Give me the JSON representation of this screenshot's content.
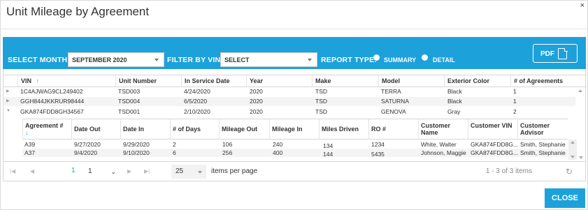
{
  "dialog": {
    "title": "Unit Mileage by Agreement",
    "close_icon": "×"
  },
  "filters": {
    "month_label": "SELECT MONTH:",
    "month_value": "SEPTEMBER 2020",
    "vin_label": "FILTER BY VIN:",
    "vin_value": "SELECT",
    "report_type_label": "REPORT TYPE:",
    "summary_label": "SUMMARY",
    "detail_label": "DETAIL",
    "pdf_label": "PDF"
  },
  "grid": {
    "columns": [
      "VIN",
      "Unit Number",
      "In Service Date",
      "Year",
      "Make",
      "Model",
      "Exterior Color",
      "# of Agreements"
    ],
    "sort_icon": "↑",
    "rows": [
      {
        "vin": "1C4AJWAG9CL249402",
        "unit": "TSD003",
        "date": "4/24/2020",
        "year": "2020",
        "make": "TSD",
        "model": "TERRA",
        "color": "Black",
        "agreements": "1"
      },
      {
        "vin": "GGH844JKKRUR98444",
        "unit": "TSD004",
        "date": "6/5/2020",
        "year": "2020",
        "make": "TSD",
        "model": "SATURNA",
        "color": "Black",
        "agreements": "1"
      },
      {
        "vin": "GKA874FDD8GH34567",
        "unit": "TSD001",
        "date": "2/10/2020",
        "year": "2020",
        "make": "TSD",
        "model": "GENOVA",
        "color": "Gray",
        "agreements": "2"
      }
    ]
  },
  "detail": {
    "columns": [
      "Agreement #",
      "Date Out",
      "Date In",
      "# of Days",
      "Mileage Out",
      "Mileage In",
      "Miles Driven",
      "RO #",
      "Customer Name",
      "Customer VIN",
      "Customer Advisor"
    ],
    "sort_icon": "↓",
    "rows": [
      {
        "agreement": "A39",
        "date_out": "9/27/2020",
        "date_in": "9/29/2020",
        "days": "2",
        "mileage_out": "106",
        "mileage_in": "240",
        "miles": "134",
        "ro": "1234",
        "customer": "White, Walter",
        "cvin": "GKA874FDD8G...",
        "advisor": "Smith, Stephanie"
      },
      {
        "agreement": "A37",
        "date_out": "9/4/2020",
        "date_in": "9/10/2020",
        "days": "6",
        "mileage_out": "256",
        "mileage_in": "400",
        "miles": "144",
        "ro": "5435",
        "customer": "Johnson, Maggie",
        "cvin": "GKA874FDD8G...",
        "advisor": "Smith, Stephanie"
      }
    ]
  },
  "pager": {
    "current_page": "1",
    "page_select": "1",
    "page_size": "25",
    "items_per_page_label": "items per page",
    "info": "1 - 3 of 3 items"
  },
  "footer": {
    "close_label": "CLOSE"
  },
  "colors": {
    "accent": "#1da1db"
  }
}
